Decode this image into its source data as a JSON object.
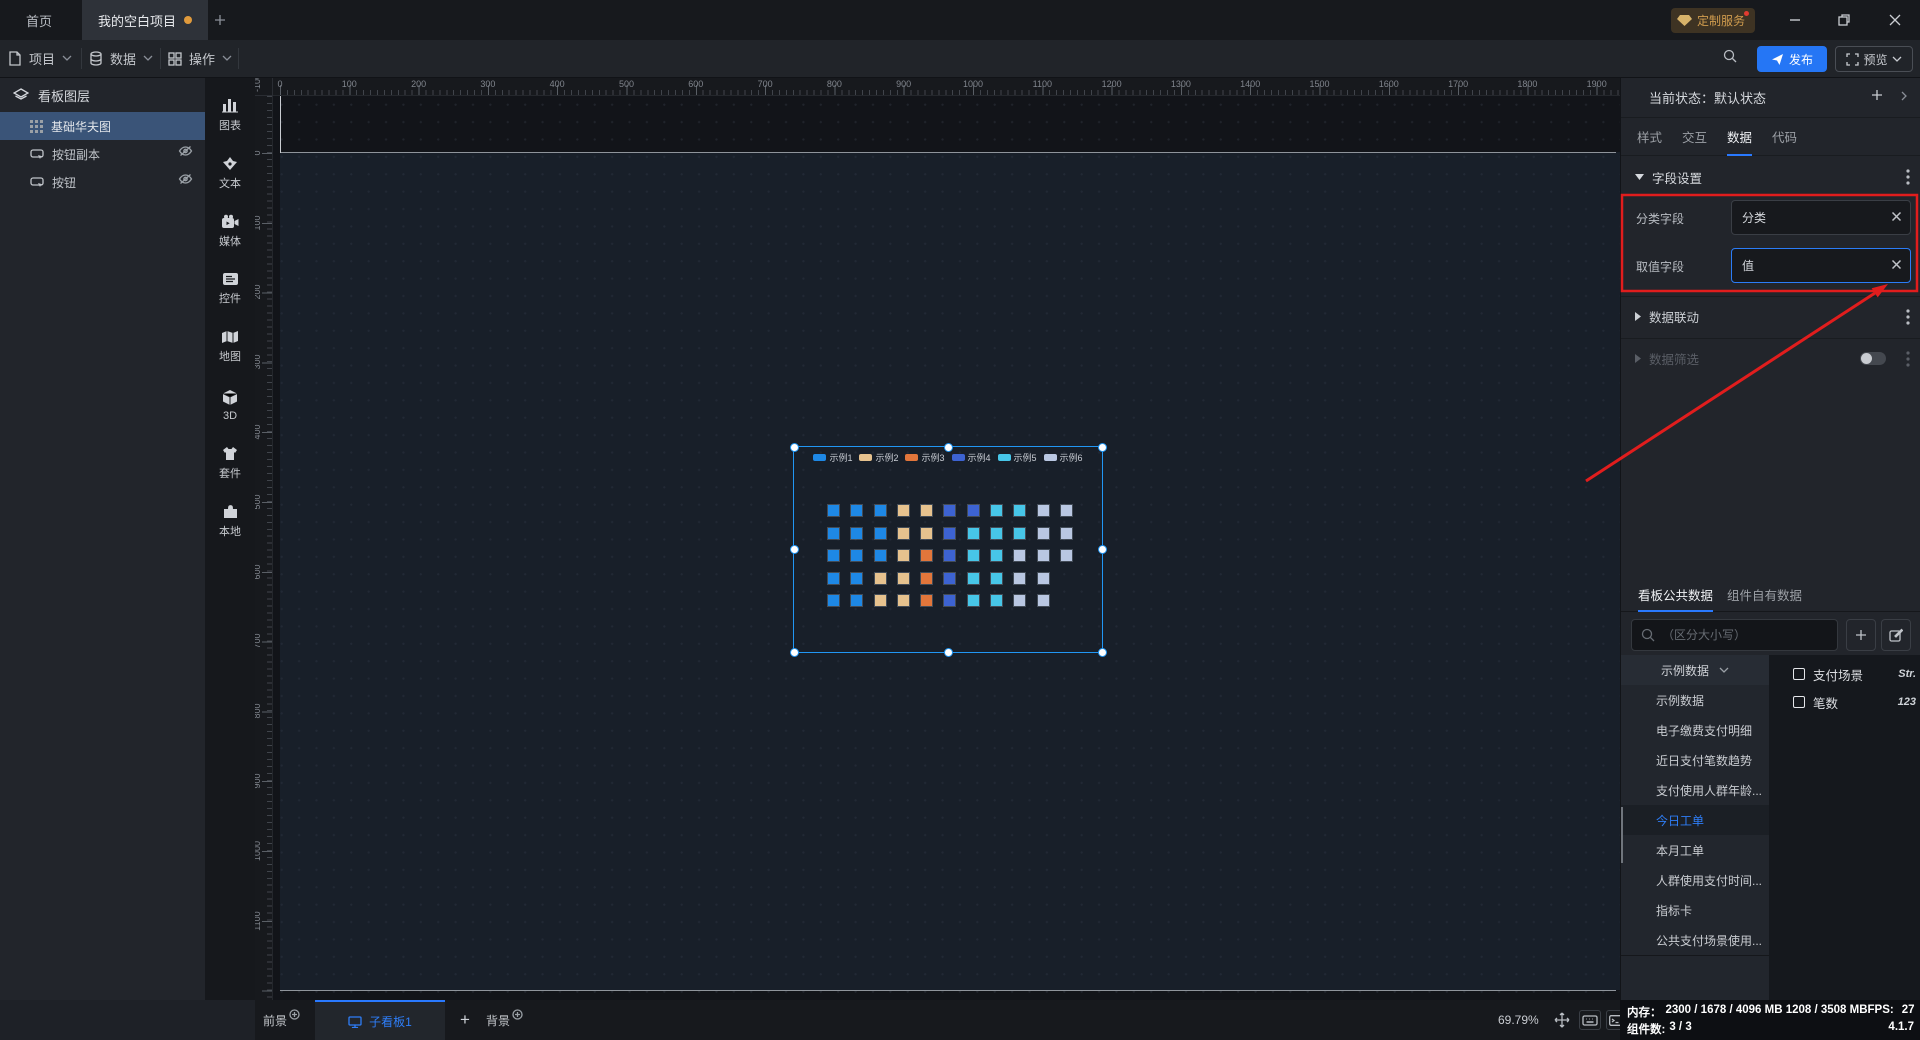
{
  "titlebar": {
    "tabs": [
      {
        "label": "首页",
        "active": false
      },
      {
        "label": "我的空白项目",
        "active": true,
        "modified_dot": true
      }
    ],
    "badge": "定制服务"
  },
  "menubar": {
    "items": [
      {
        "icon": "file-icon",
        "label": "项目"
      },
      {
        "icon": "database-icon",
        "label": "数据"
      },
      {
        "icon": "grid-icon",
        "label": "操作"
      }
    ],
    "publish": "发布",
    "preview": "预览"
  },
  "sidebar": {
    "title": "看板图层",
    "layers": [
      {
        "icon": "waffle-icon",
        "label": "基础华夫图",
        "selected": true,
        "hidden": false
      },
      {
        "icon": "button-icon",
        "label": "按钮副本",
        "selected": false,
        "hidden": true
      },
      {
        "icon": "button-icon",
        "label": "按钮",
        "selected": false,
        "hidden": true
      }
    ]
  },
  "toolbox": {
    "items": [
      {
        "icon": "chart-icon",
        "label": "图表"
      },
      {
        "icon": "text-icon",
        "label": "文本"
      },
      {
        "icon": "media-icon",
        "label": "媒体"
      },
      {
        "icon": "widget-icon",
        "label": "控件"
      },
      {
        "icon": "map-icon",
        "label": "地图"
      },
      {
        "icon": "cube-icon",
        "label": "3D"
      },
      {
        "icon": "kit-icon",
        "label": "套件"
      },
      {
        "icon": "local-icon",
        "label": "本地"
      }
    ]
  },
  "canvas": {
    "ruler_top_labels": [
      "0",
      "100",
      "200",
      "300",
      "400",
      "500",
      "600",
      "700",
      "800",
      "900",
      "1000",
      "1100",
      "1200",
      "1300",
      "1400",
      "1500",
      "1600",
      "1700",
      "1800",
      "1900"
    ],
    "ruler_left_labels": [
      "-100",
      "0",
      "100",
      "200",
      "300",
      "400",
      "500",
      "600",
      "700",
      "800",
      "900",
      "1000",
      "1100"
    ]
  },
  "chart_data": {
    "type": "waffle",
    "title": "基础华夫图",
    "legend_position": "top",
    "series": [
      {
        "name": "示例1",
        "color": "#1e88e5",
        "value": 13
      },
      {
        "name": "示例2",
        "color": "#e6c28e",
        "value": 9
      },
      {
        "name": "示例3",
        "color": "#e2763b",
        "value": 3
      },
      {
        "name": "示例4",
        "color": "#3d63d2",
        "value": 6
      },
      {
        "name": "示例5",
        "color": "#47c6e8",
        "value": 11
      },
      {
        "name": "示例6",
        "color": "#b9c7e2",
        "value": 11
      }
    ],
    "grid_rows": [
      [
        1,
        1,
        1,
        2,
        2,
        4,
        4,
        5,
        5,
        6,
        6
      ],
      [
        1,
        1,
        1,
        2,
        2,
        4,
        5,
        5,
        5,
        6,
        6
      ],
      [
        1,
        1,
        1,
        2,
        3,
        4,
        5,
        5,
        6,
        6,
        6
      ],
      [
        1,
        1,
        2,
        2,
        3,
        4,
        5,
        5,
        6,
        6
      ],
      [
        1,
        1,
        2,
        2,
        3,
        4,
        5,
        5,
        6,
        6
      ]
    ]
  },
  "inspector": {
    "state_label": "当前状态：",
    "state_value": "默认状态",
    "tabs": [
      "样式",
      "交互",
      "数据",
      "代码"
    ],
    "active_tab": "数据",
    "field_section": "字段设置",
    "fields": [
      {
        "label": "分类字段",
        "value": "分类",
        "focused": false
      },
      {
        "label": "取值字段",
        "value": "值",
        "focused": true
      }
    ],
    "data_link": "数据联动",
    "data_filter": "数据筛选"
  },
  "data_panel": {
    "tabs": [
      "看板公共数据",
      "组件自有数据"
    ],
    "active_tab": "看板公共数据",
    "search_placeholder": "（区分大小写）",
    "dataset_selected": "示例数据",
    "datasets": [
      "示例数据",
      "电子缴费支付明细",
      "近日支付笔数趋势",
      "支付使用人群年龄...",
      "今日工单",
      "本月工单",
      "人群使用支付时间...",
      "指标卡",
      "公共支付场景使用..."
    ],
    "dataset_active": "今日工单",
    "fields": [
      {
        "name": "支付场景",
        "type": "Str."
      },
      {
        "name": "笔数",
        "type": "123"
      }
    ]
  },
  "statusbar": {
    "foreground": "前景",
    "subboard": "子看板1",
    "background": "背景",
    "zoom": "69.79%",
    "memory_label": "内存：",
    "memory_value": "2300 / 1678 / 4096 MB  1208 / 3508 MB",
    "fps_label": "FPS:",
    "fps_value": "27",
    "components_label": "组件数:",
    "components_value": "3 / 3",
    "version": "4.1.7"
  },
  "annotation": {
    "color": "#e11d1d"
  }
}
